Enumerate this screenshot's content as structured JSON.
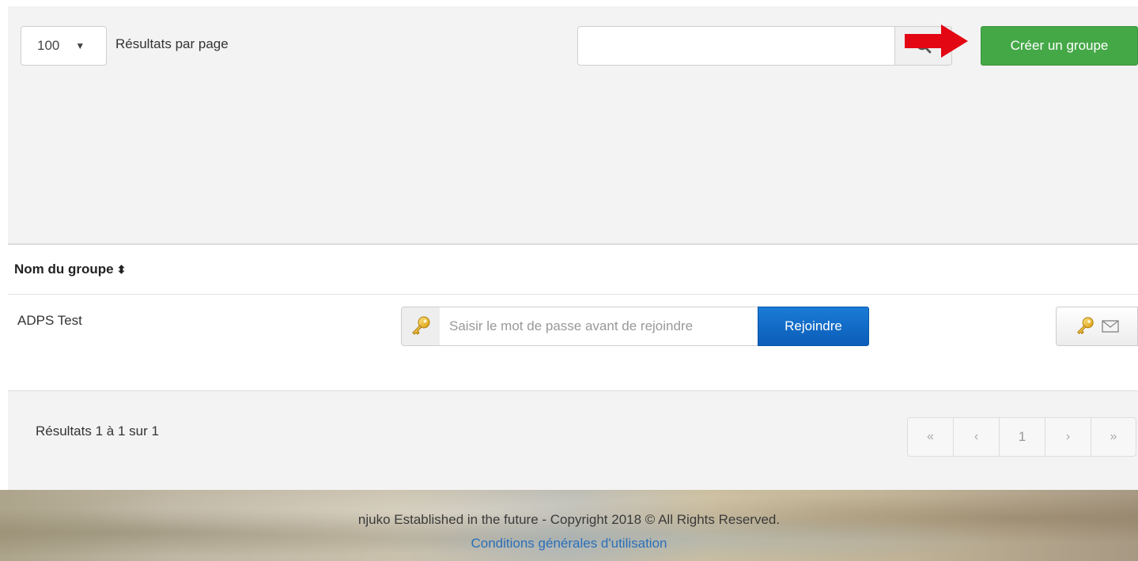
{
  "controls": {
    "page_size_value": "100",
    "page_size_caret": "▼",
    "per_page_label": "Résultats par page",
    "search_value": "",
    "create_button_label": "Créer un groupe"
  },
  "table": {
    "column_header": "Nom du groupe",
    "sort_glyph": "⬍",
    "rows": [
      {
        "name": "ADPS Test",
        "password_placeholder": "Saisir le mot de passe avant de rejoindre",
        "join_label": "Rejoindre"
      }
    ]
  },
  "footer_bar": {
    "results_info": "Résultats 1 à 1 sur 1",
    "pagination": {
      "first": "«",
      "prev": "‹",
      "current": "1",
      "next": "›",
      "last": "»"
    }
  },
  "site_footer": {
    "copyright": "njuko Established in the future - Copyright 2018 © All Rights Reserved.",
    "terms_link": "Conditions générales d'utilisation"
  },
  "colors": {
    "create_button": "#44a847",
    "join_button": "#0b5db8",
    "arrow": "#e30613",
    "link": "#2a6fb8"
  },
  "icons": {
    "search": "search-icon",
    "arrow": "arrow-right-icon",
    "key": "key-icon",
    "mail": "envelope-icon"
  }
}
